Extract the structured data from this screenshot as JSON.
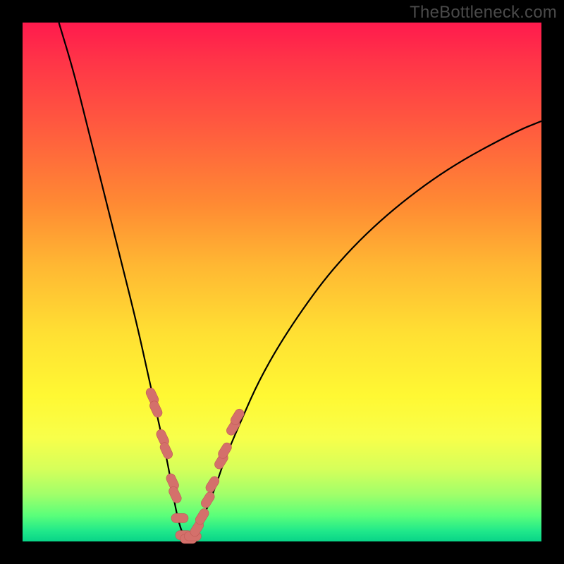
{
  "watermark": "TheBottleneck.com",
  "colors": {
    "background": "#000000",
    "curve_stroke": "#000000",
    "marker_fill": "#d4706b",
    "marker_stroke": "#c05a55",
    "gradient_top": "#ff1a4d",
    "gradient_bottom": "#08d488"
  },
  "chart_data": {
    "type": "line",
    "title": "",
    "xlabel": "",
    "ylabel": "",
    "xlim": [
      0,
      100
    ],
    "ylim": [
      0,
      100
    ],
    "curve_note": "V-shaped bottleneck curve; y is mismatch %, minimum near x≈31",
    "series": [
      {
        "name": "bottleneck-curve",
        "x": [
          7,
          10,
          13,
          16,
          19,
          22,
          24,
          26,
          28,
          29,
          30,
          31,
          32,
          33,
          35,
          37,
          39,
          42,
          46,
          52,
          60,
          70,
          82,
          95,
          100
        ],
        "y": [
          100,
          90,
          78,
          66,
          54,
          42,
          33,
          24,
          15,
          9,
          4,
          1,
          1,
          2,
          5,
          10,
          16,
          23,
          32,
          42,
          53,
          63,
          72,
          79,
          81
        ]
      }
    ],
    "markers": {
      "name": "highlighted-points",
      "note": "pink bead-like markers clustered near bottom of the V",
      "x": [
        25.0,
        25.7,
        27.0,
        27.7,
        28.9,
        29.4,
        30.3,
        31.1,
        32.0,
        32.8,
        33.6,
        34.6,
        35.7,
        36.6,
        38.3,
        39.0,
        40.6,
        41.4
      ],
      "y": [
        28.0,
        25.5,
        20.0,
        17.5,
        11.5,
        9.0,
        4.5,
        1.2,
        0.5,
        1.0,
        2.5,
        4.8,
        8.0,
        11.0,
        15.5,
        17.5,
        22.0,
        24.0
      ]
    }
  }
}
